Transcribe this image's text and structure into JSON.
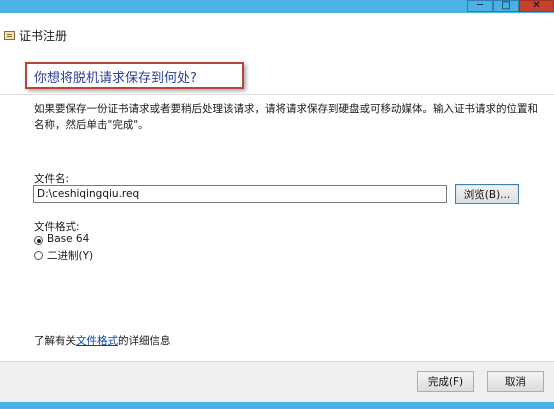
{
  "window": {
    "title": "证书注册",
    "controls": {
      "minimize": "─",
      "maximize": "□",
      "close": "✕"
    }
  },
  "heading": "你想将脱机请求保存到何处?",
  "description": "如果要保存一份证书请求或者要稍后处理该请求，请将请求保存到硬盘或可移动媒体。输入证书请求的位置和名称，然后单击\"完成\"。",
  "filename": {
    "label": "文件名:",
    "value": "D:\\ceshiqingqiu.req",
    "browse_button": "浏览(B)..."
  },
  "format": {
    "label": "文件格式:",
    "options": [
      {
        "label": "Base 64",
        "checked": true
      },
      {
        "label": "二进制(Y)",
        "checked": false
      }
    ]
  },
  "help": {
    "prefix": "了解有关",
    "link": "文件格式",
    "suffix": "的详细信息"
  },
  "buttons": {
    "finish": "完成(F)",
    "cancel": "取消"
  },
  "colors": {
    "accent": "#4ab2e4",
    "heading": "#2a3f9b",
    "highlight_box": "#b5473a",
    "link": "#0645ad"
  }
}
